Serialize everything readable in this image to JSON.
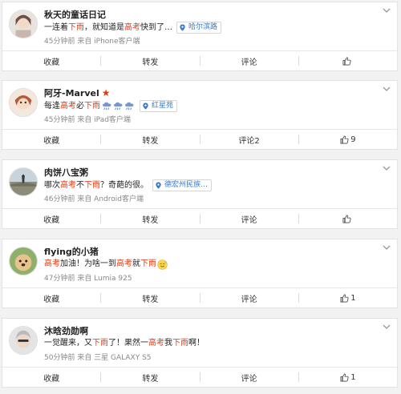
{
  "posts": [
    {
      "username": "秋天的童话日记",
      "verified": false,
      "segments": [
        {
          "t": "一连着",
          "h": false
        },
        {
          "t": "下雨",
          "h": true
        },
        {
          "t": "，就知道是",
          "h": false
        },
        {
          "t": "高考",
          "h": true
        },
        {
          "t": "快到了…",
          "h": false
        }
      ],
      "location": "哈尔滨路",
      "meta": "45分钟前 来自 iPhone客户端",
      "actions": {
        "collect": "收藏",
        "repost": "转发",
        "comment": "评论",
        "like": ""
      }
    },
    {
      "username": "阿牙-Marvel",
      "verified": true,
      "segments": [
        {
          "t": "每逢",
          "h": false
        },
        {
          "t": "高考",
          "h": true
        },
        {
          "t": "必",
          "h": false
        },
        {
          "t": "下雨",
          "h": true
        }
      ],
      "rain_icons": 3,
      "location": "红星苑",
      "meta": "45分钟前 来自 iPad客户端",
      "actions": {
        "collect": "收藏",
        "repost": "转发",
        "comment": "评论2",
        "like": "9"
      }
    },
    {
      "username": "肉饼八宝粥",
      "verified": false,
      "segments": [
        {
          "t": "哪次",
          "h": false
        },
        {
          "t": "高考",
          "h": true
        },
        {
          "t": "不",
          "h": false
        },
        {
          "t": "下雨",
          "h": true
        },
        {
          "t": "？奇葩的很。",
          "h": false
        }
      ],
      "location": "德宏州民族…",
      "meta": "46分钟前 来自 Android客户端",
      "actions": {
        "collect": "收藏",
        "repost": "转发",
        "comment": "评论",
        "like": ""
      }
    },
    {
      "username": "flying的小猪",
      "verified": false,
      "segments": [
        {
          "t": "高考",
          "h": true
        },
        {
          "t": "加油！为啥一到",
          "h": false
        },
        {
          "t": "高考",
          "h": true
        },
        {
          "t": "就",
          "h": false
        },
        {
          "t": "下雨",
          "h": true
        }
      ],
      "emoji": "sweat-smile-emoji",
      "meta": "47分钟前 来自 Lumia 925",
      "actions": {
        "collect": "收藏",
        "repost": "转发",
        "comment": "评论",
        "like": "1"
      }
    },
    {
      "username": "沐晗劲勋啊",
      "verified": false,
      "segments": [
        {
          "t": "一觉醒来，又",
          "h": false
        },
        {
          "t": "下雨",
          "h": true
        },
        {
          "t": "了！果然一",
          "h": false
        },
        {
          "t": "高考",
          "h": true
        },
        {
          "t": "我",
          "h": false
        },
        {
          "t": "下雨",
          "h": true
        },
        {
          "t": "啊！",
          "h": false
        }
      ],
      "meta": "50分钟前 来自 三星 GALAXY S5",
      "actions": {
        "collect": "收藏",
        "repost": "转发",
        "comment": "评论",
        "like": "1"
      }
    }
  ],
  "colors": {
    "highlight": "#e8360c",
    "location": "#3878c8",
    "text": "#222222",
    "meta": "#888888"
  }
}
